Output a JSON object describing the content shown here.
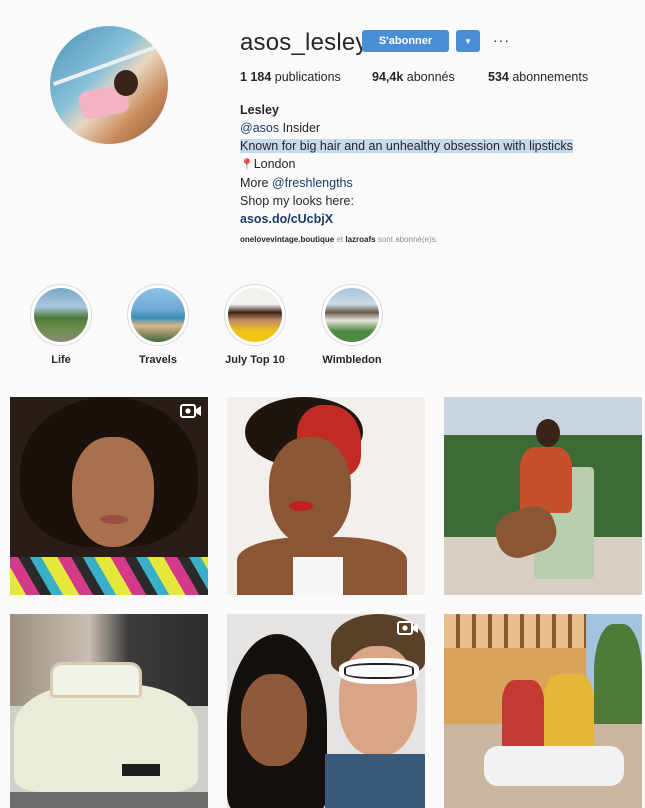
{
  "profile": {
    "username": "asos_lesley",
    "follow_label": "S'abonner",
    "caret_label": "▼",
    "more_label": "···",
    "stats": {
      "posts_count": "1 184",
      "posts_label": "publications",
      "followers_count": "94,4k",
      "followers_label": "abonnés",
      "following_count": "534",
      "following_label": "abonnements"
    },
    "bio": {
      "name": "Lesley",
      "mention": "@asos",
      "role": "Insider",
      "line_highlight": "Known for big hair and an unhealthy obsession with lipsticks",
      "pin": "📍",
      "location": "London",
      "more_prefix": "More",
      "more_handle": "@freshlengths",
      "shop": "Shop my looks here:",
      "url": "asos.do/cUcbjX"
    },
    "followed_by": {
      "user1": "onelovevintage.boutique",
      "and": "et",
      "user2": "lazroafs",
      "suffix": "sont abonné(e)s."
    }
  },
  "highlights": [
    {
      "label": "Life"
    },
    {
      "label": "Travels"
    },
    {
      "label": "July Top 10"
    },
    {
      "label": "Wimbledon"
    }
  ],
  "posts": [
    {
      "type": "video",
      "name": "post-portrait-curly-hair"
    },
    {
      "type": "photo",
      "name": "post-red-headscarf"
    },
    {
      "type": "photo",
      "name": "post-green-chair"
    },
    {
      "type": "photo",
      "name": "post-vintage-car"
    },
    {
      "type": "video",
      "name": "post-couple-sunglasses"
    },
    {
      "type": "photo",
      "name": "post-couple-sitting"
    }
  ],
  "colors": {
    "accent": "#4a8fd6",
    "link": "#1c3b66",
    "highlight": "#c7d9ee"
  },
  "icons": {
    "video": "video-camera-icon",
    "more": "more-options-icon",
    "caret": "chevron-down-icon",
    "pin": "location-pin-icon"
  }
}
